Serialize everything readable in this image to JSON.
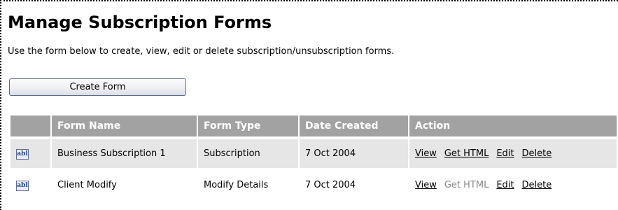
{
  "page": {
    "title": "Manage Subscription Forms",
    "intro": "Use the form below to create, view, edit or delete subscription/unsubscription forms.",
    "create_button": "Create Form"
  },
  "table": {
    "headers": {
      "icon": "",
      "name": "Form Name",
      "type": "Form Type",
      "date": "Date Created",
      "action": "Action"
    },
    "rows": [
      {
        "icon": "abl",
        "name": "Business Subscription 1",
        "type": "Subscription",
        "date": "7 Oct 2004",
        "actions": {
          "view": "View",
          "get_html": "Get HTML",
          "edit": "Edit",
          "delete": "Delete"
        },
        "get_html_enabled": true
      },
      {
        "icon": "abl",
        "name": "Client Modify",
        "type": "Modify Details",
        "date": "7 Oct 2004",
        "actions": {
          "view": "View",
          "get_html": "Get HTML",
          "edit": "Edit",
          "delete": "Delete"
        },
        "get_html_enabled": false
      }
    ]
  },
  "colors": {
    "header_bg": "#a2a2a2",
    "row_alt_bg": "#e6e6e6",
    "disabled_text": "#888888"
  }
}
